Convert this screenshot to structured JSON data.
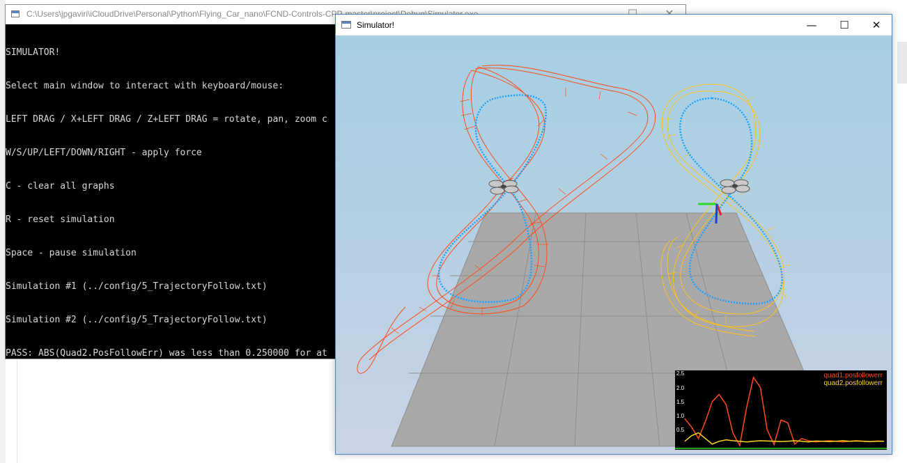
{
  "console": {
    "title": "C:\\Users\\jpgaviri\\iCloudDrive\\Personal\\Python\\Flying_Car_nano\\FCND-Controls-CPP-master\\project\\Debug\\Simulator.exe",
    "lines": [
      "SIMULATOR!",
      "Select main window to interact with keyboard/mouse:",
      "LEFT DRAG / X+LEFT DRAG / Z+LEFT DRAG = rotate, pan, zoom c",
      "W/S/UP/LEFT/DOWN/RIGHT - apply force",
      "C - clear all graphs",
      "R - reset simulation",
      "Space - pause simulation",
      "Simulation #1 (../config/5_TrajectoryFollow.txt)",
      "Simulation #2 (../config/5_TrajectoryFollow.txt)",
      "PASS: ABS(Quad2.PosFollowErr) was less than 0.250000 for at"
    ],
    "controls": {
      "minimize": "—",
      "maximize": "☐",
      "close": "✕"
    }
  },
  "simulator": {
    "title": "Simulator!",
    "controls": {
      "minimize": "—",
      "maximize": "☐",
      "close": "✕"
    },
    "colors": {
      "quad1": "#ff4a16",
      "quad2": "#ffd21e",
      "trajectory": "#1aa0ff",
      "floor": "#a9a9a9"
    }
  },
  "graph": {
    "legend": [
      "quad1.posfollowerr",
      "quad2.posfollowerr"
    ],
    "yticks": [
      "2.5",
      "2.0",
      "1.5",
      "1.0",
      "0.5"
    ],
    "chart_data": {
      "type": "line",
      "ylim": [
        0,
        2.6
      ],
      "series": [
        {
          "name": "quad1.posfollowerr",
          "color": "#ff4a16",
          "values": [
            1.0,
            0.7,
            0.3,
            0.9,
            1.6,
            1.85,
            1.5,
            0.5,
            0.05,
            1.4,
            2.45,
            2.1,
            0.6,
            0.08,
            0.95,
            0.85,
            0.1,
            0.3,
            0.22,
            0.18,
            0.2,
            0.22,
            0.2,
            0.18,
            0.2,
            0.22,
            0.2,
            0.19,
            0.21,
            0.2
          ]
        },
        {
          "name": "quad2.posfollowerr",
          "color": "#ffd21e",
          "values": [
            0.2,
            0.4,
            0.5,
            0.3,
            0.1,
            0.2,
            0.25,
            0.22,
            0.2,
            0.18,
            0.2,
            0.22,
            0.21,
            0.2,
            0.19,
            0.2,
            0.22,
            0.2,
            0.18,
            0.21,
            0.2,
            0.19,
            0.2,
            0.22,
            0.2,
            0.21,
            0.2,
            0.19,
            0.2,
            0.2
          ]
        }
      ]
    }
  }
}
